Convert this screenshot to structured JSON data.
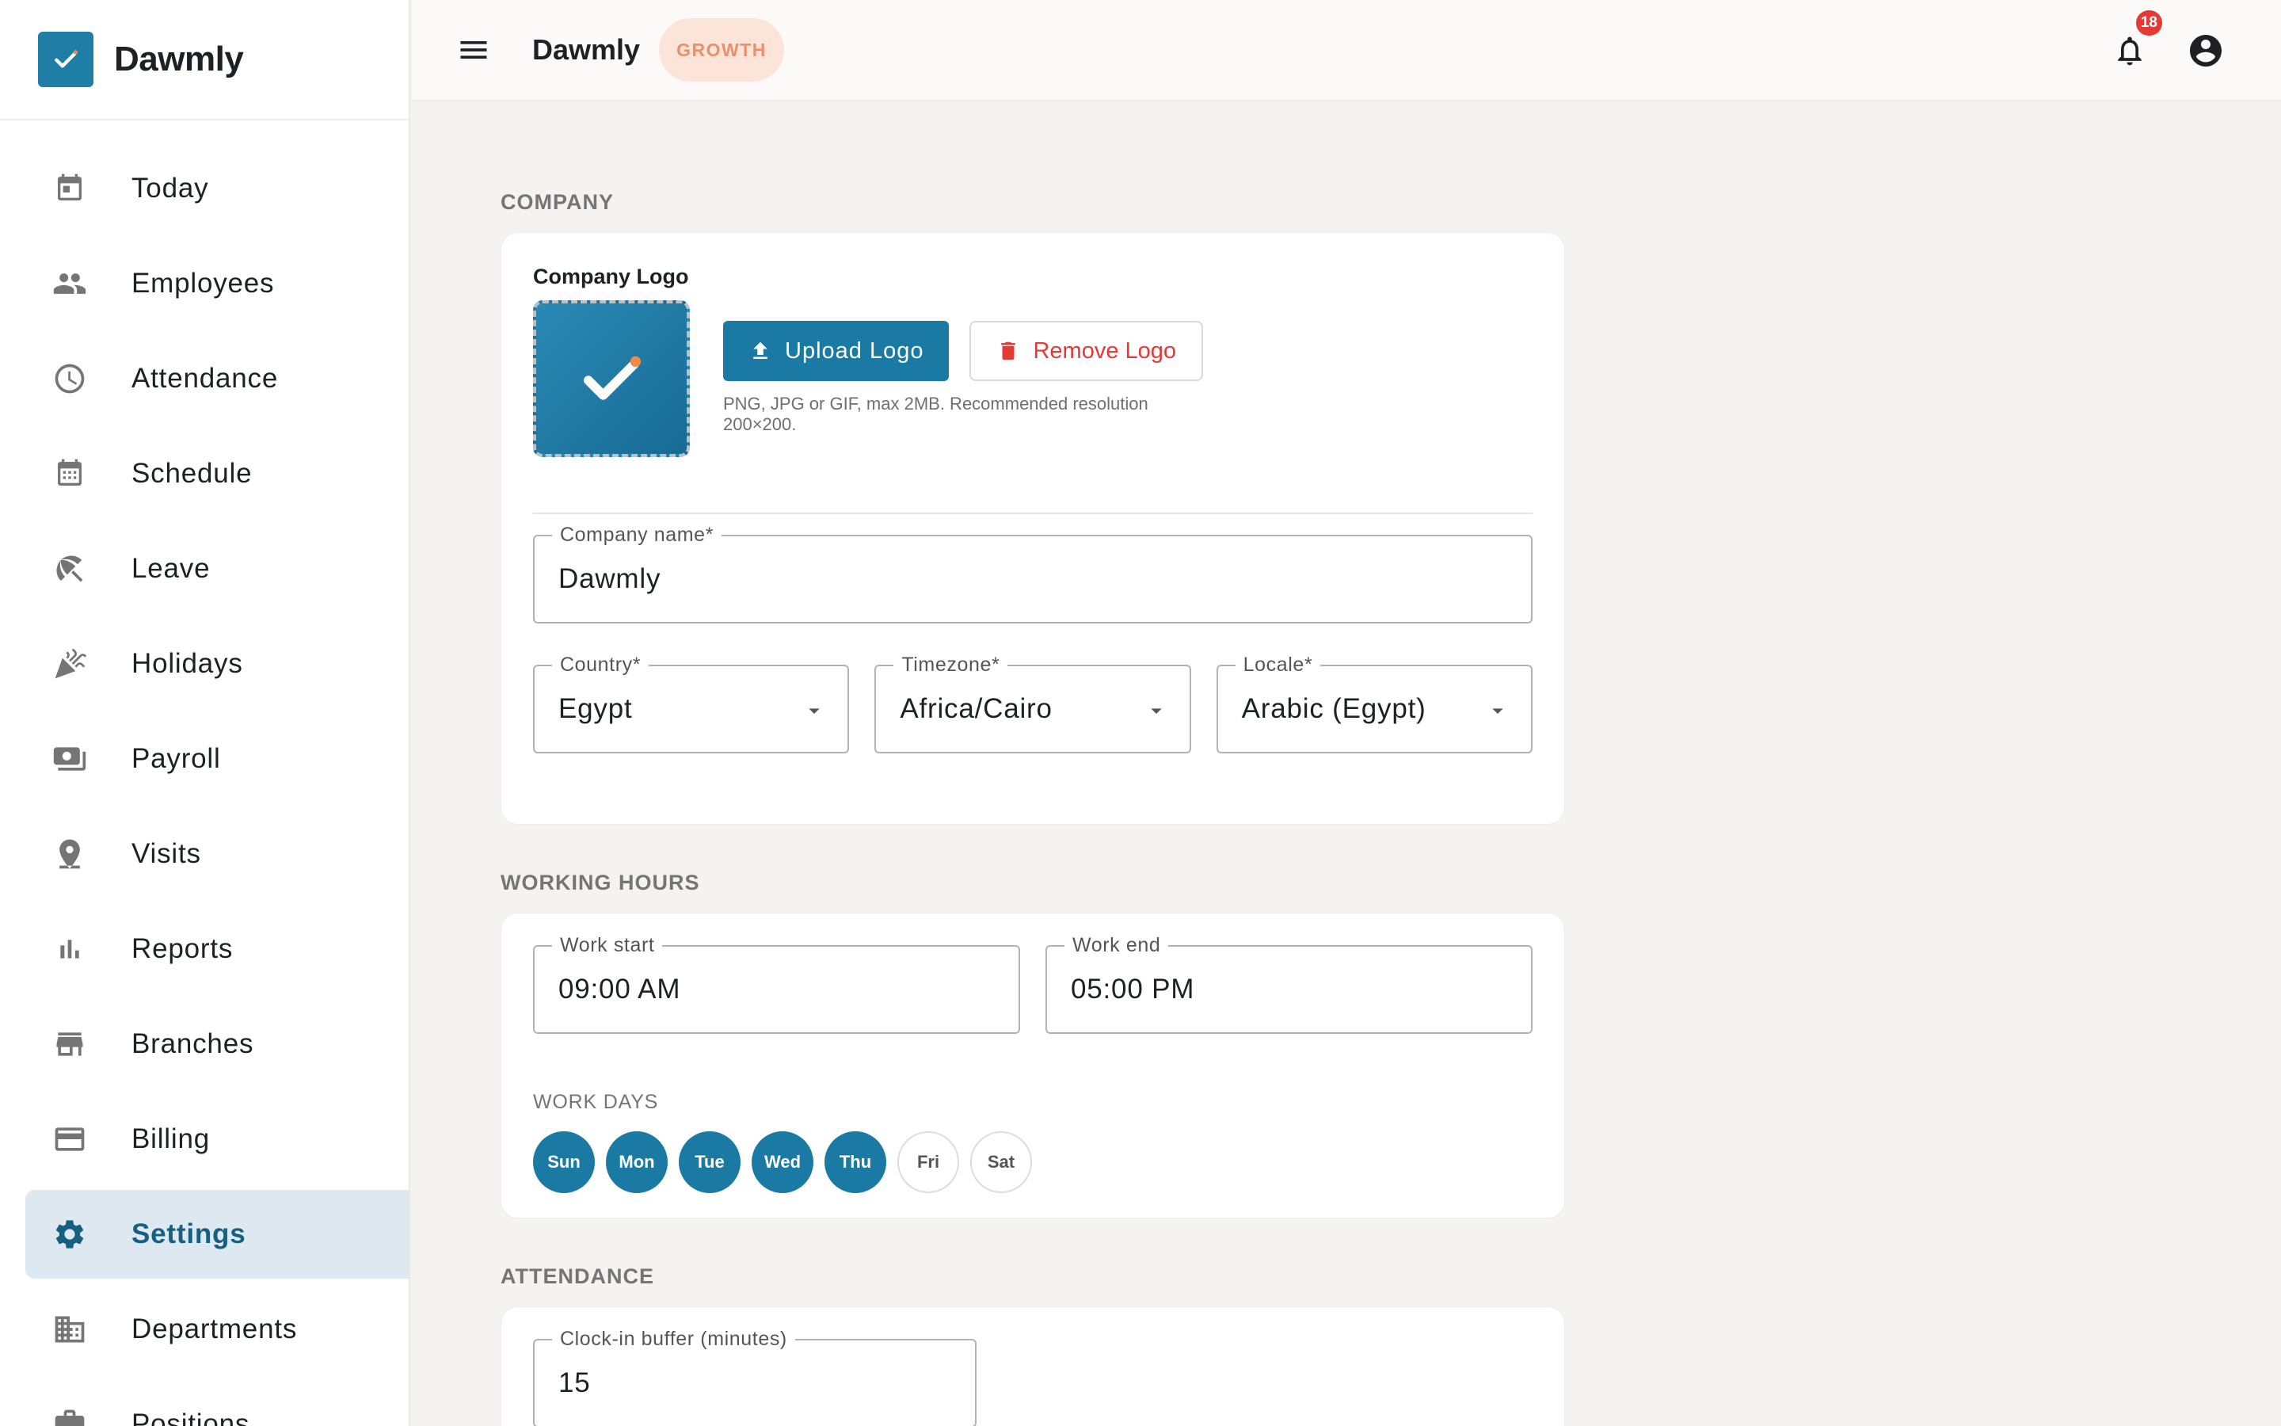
{
  "app": {
    "name": "Dawmly",
    "plan": "GROWTH",
    "notifications_count": "18"
  },
  "sidebar": {
    "items": [
      {
        "label": "Today",
        "icon": "calendar-today-icon"
      },
      {
        "label": "Employees",
        "icon": "people-icon"
      },
      {
        "label": "Attendance",
        "icon": "clock-icon"
      },
      {
        "label": "Schedule",
        "icon": "calendar-grid-icon"
      },
      {
        "label": "Leave",
        "icon": "beach-umbrella-icon"
      },
      {
        "label": "Holidays",
        "icon": "celebration-icon"
      },
      {
        "label": "Payroll",
        "icon": "payments-icon"
      },
      {
        "label": "Visits",
        "icon": "location-pin-icon"
      },
      {
        "label": "Reports",
        "icon": "bar-chart-icon"
      },
      {
        "label": "Branches",
        "icon": "store-icon"
      },
      {
        "label": "Billing",
        "icon": "credit-card-icon"
      },
      {
        "label": "Settings",
        "icon": "gear-icon",
        "active": true
      },
      {
        "label": "Departments",
        "icon": "domain-icon"
      },
      {
        "label": "Positions",
        "icon": "briefcase-icon"
      }
    ]
  },
  "company": {
    "section_title": "COMPANY",
    "logo_label": "Company Logo",
    "upload_label": "Upload Logo",
    "remove_label": "Remove Logo",
    "logo_hint": "PNG, JPG or GIF, max 2MB. Recommended resolution 200×200.",
    "name_label": "Company name",
    "name_value": "Dawmly",
    "country_label": "Country",
    "country_value": "Egypt",
    "timezone_label": "Timezone",
    "timezone_value": "Africa/Cairo",
    "locale_label": "Locale",
    "locale_value": "Arabic (Egypt)",
    "required_mark": "*"
  },
  "working_hours": {
    "section_title": "WORKING HOURS",
    "start_label": "Work start",
    "start_value": "09:00 AM",
    "end_label": "Work end",
    "end_value": "05:00 PM",
    "days_label": "WORK DAYS",
    "days": [
      {
        "label": "Sun",
        "selected": true
      },
      {
        "label": "Mon",
        "selected": true
      },
      {
        "label": "Tue",
        "selected": true
      },
      {
        "label": "Wed",
        "selected": true
      },
      {
        "label": "Thu",
        "selected": true
      },
      {
        "label": "Fri",
        "selected": false
      },
      {
        "label": "Sat",
        "selected": false
      }
    ]
  },
  "attendance": {
    "section_title": "ATTENDANCE",
    "buffer_label": "Clock-in buffer (minutes)",
    "buffer_value": "15"
  },
  "colors": {
    "primary": "#1b7aa3",
    "accent_orange": "#e8906a",
    "danger": "#e53935",
    "active_nav_bg": "#dde8f0"
  }
}
